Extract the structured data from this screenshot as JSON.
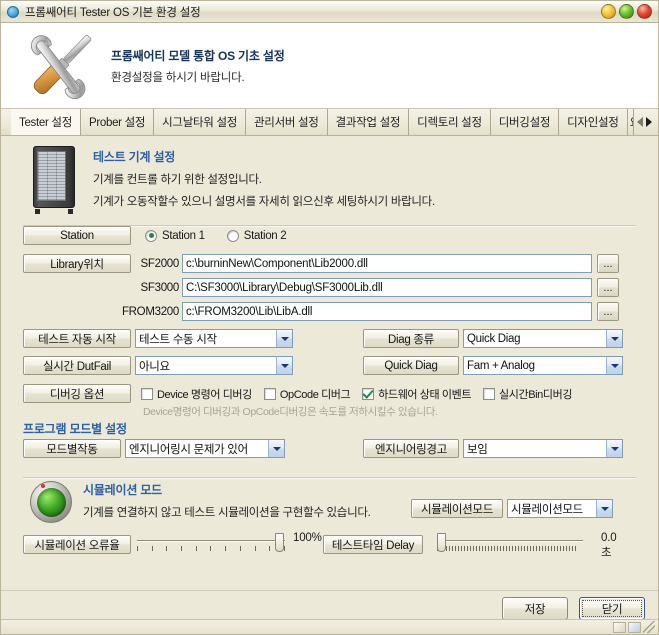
{
  "window": {
    "title": "프롬쌔어티 Tester OS 기본 환경 설정",
    "buttons": {
      "minimize": "minimize",
      "maximize": "maximize",
      "close": "close"
    }
  },
  "banner": {
    "title": "프롬쌔어티 모델 통합 OS 기초 설정",
    "subtitle": "환경설정을 하시기 바랍니다."
  },
  "tabs": [
    {
      "label": "Tester 설정",
      "active": true
    },
    {
      "label": "Prober 설정",
      "active": false
    },
    {
      "label": "시그날타워 설정",
      "active": false
    },
    {
      "label": "관리서버 설정",
      "active": false
    },
    {
      "label": "결과작업 설정",
      "active": false
    },
    {
      "label": "디렉토리 설정",
      "active": false
    },
    {
      "label": "디버깅설정",
      "active": false
    },
    {
      "label": "디자인설정",
      "active": false
    },
    {
      "label": "요",
      "active": false
    }
  ],
  "section": {
    "title": "테스트 기계 설정",
    "line1": "기계를 컨트롤 하기 위한 설정입니다.",
    "line2": "기계가 오동작할수 있으니 설명서를 자세히 읽으신후 세팅하시기 바랍니다."
  },
  "station": {
    "label": "Station",
    "option1": "Station 1",
    "option2": "Station 2",
    "selected": "Station 1"
  },
  "library": {
    "label": "Library위치",
    "rows": [
      {
        "name": "SF2000",
        "value": "c:\\burninNew\\Component\\Lib2000.dll",
        "browse": "..."
      },
      {
        "name": "SF3000",
        "value": "C:\\SF3000\\Library\\Debug\\SF3000Lib.dll",
        "browse": "..."
      },
      {
        "name": "FROM3200",
        "value": "c:\\FROM3200\\Lib\\LibA.dll",
        "browse": "..."
      }
    ]
  },
  "options": {
    "auto_start": {
      "label": "테스트 자동 시작",
      "value": "테스트 수동 시작"
    },
    "dutfail": {
      "label": "실시간 DutFail",
      "value": "아니요"
    },
    "diag_type": {
      "label": "Diag 종류",
      "value": "Quick Diag"
    },
    "quick_diag": {
      "label": "Quick Diag",
      "value": "Fam + Analog"
    }
  },
  "debug": {
    "label": "디버깅 옵션",
    "checks": [
      {
        "label": "Device 명령어 디버깅",
        "checked": false
      },
      {
        "label": "OpCode 디버그",
        "checked": false
      },
      {
        "label": "하드웨어 상태 이벤트",
        "checked": true
      },
      {
        "label": "실시간Bin디버깅",
        "checked": false
      }
    ],
    "hint": "Device명령어 디버깅과 OpCode디버깅은 속도를 저하시킬수 있습니다."
  },
  "program_mode": {
    "title": "프로그램 모드별 설정",
    "mode_action": {
      "label": "모드별작동",
      "value": "엔지니어링시 문제가 있어"
    },
    "eng_warn": {
      "label": "엔지니어링경고",
      "value": "보임"
    }
  },
  "simulation": {
    "title": "시뮬레이션 모드",
    "desc": "기계를 연결하지 않고 테스트 시뮬레이션을 구현할수 있습니다.",
    "mode_label": "시뮬레이션모드",
    "mode_value": "시뮬레이션모드",
    "error_rate_label": "시뮬레이션 오류율",
    "error_rate_value": "100%",
    "delay_label": "테스트타임 Delay",
    "delay_value": "0.0초"
  },
  "footer": {
    "save": "저장",
    "close": "닫기"
  },
  "colors": {
    "window_bg": "#ece9d8",
    "section_title": "#2d5fa4",
    "banner_title": "#15325b",
    "field_border": "#7f9db9",
    "check_green": "#1f8a3c"
  }
}
